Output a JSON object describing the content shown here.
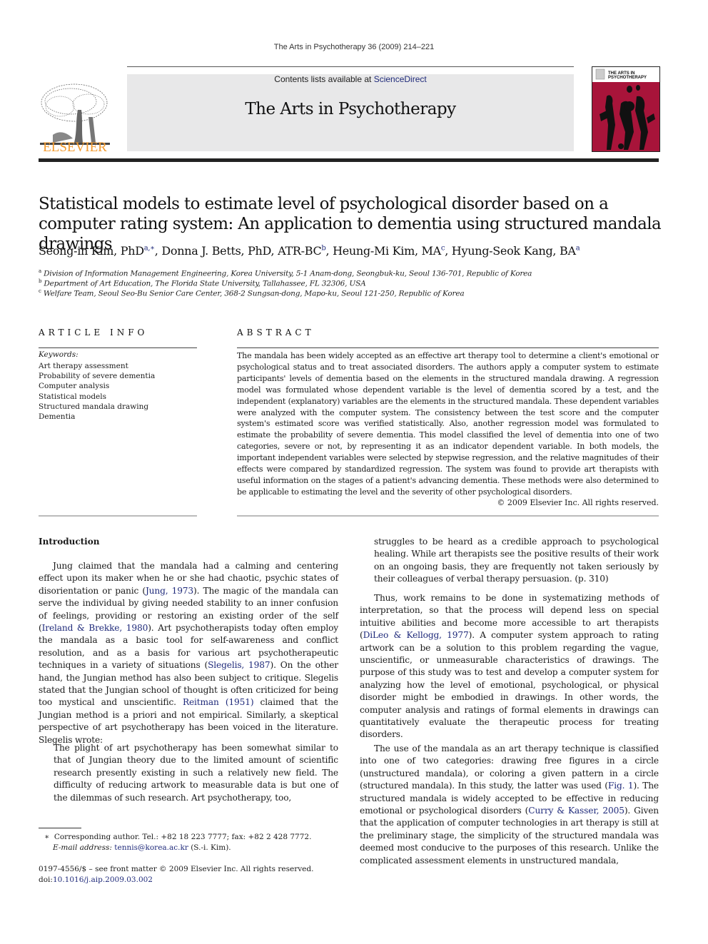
{
  "running_head": "The Arts in Psychotherapy 36 (2009) 214–221",
  "masthead": {
    "contents_prefix": "Contents lists available at ",
    "contents_link": "ScienceDirect",
    "journal_title": "The Arts in Psychotherapy",
    "publisher_wordmark": "ELSEVIER",
    "cover_title_line1": "THE ARTS IN",
    "cover_title_line2": "PSYCHOTHERAPY",
    "colors": {
      "publisher_orange": "#f29a2e",
      "cover_red": "#a8143a",
      "link_blue": "#1f2a7a",
      "masthead_gray": "#e8e8e9"
    }
  },
  "article": {
    "title": "Statistical models to estimate level of psychological disorder based on a computer rating system: An application to dementia using structured mandala drawings",
    "authors": [
      {
        "name": "Seong-in Kim, PhD",
        "sup": "a,∗"
      },
      {
        "name": "Donna J. Betts, PhD, ATR-BC",
        "sup": "b"
      },
      {
        "name": "Heung-Mi Kim, MA",
        "sup": "c"
      },
      {
        "name": "Hyung-Seok Kang, BA",
        "sup": "a"
      }
    ],
    "affiliations": [
      {
        "sup": "a",
        "text": "Division of Information Management Engineering, Korea University, 5-1 Anam-dong, Seongbuk-ku, Seoul 136-701, Republic of Korea"
      },
      {
        "sup": "b",
        "text": "Department of Art Education, The Florida State University, Tallahassee, FL 32306, USA"
      },
      {
        "sup": "c",
        "text": "Welfare Team, Seoul Seo-Bu Senior Care Center, 368-2 Sungsan-dong, Mapo-ku, Seoul 121-250, Republic of Korea"
      }
    ]
  },
  "article_info": {
    "heading": "ARTICLE INFO",
    "keywords_label": "Keywords:",
    "keywords": [
      "Art therapy assessment",
      "Probability of severe dementia",
      "Computer analysis",
      "Statistical models",
      "Structured mandala drawing",
      "Dementia"
    ]
  },
  "abstract": {
    "heading": "ABSTRACT",
    "text": "The mandala has been widely accepted as an effective art therapy tool to determine a client's emotional or psychological status and to treat associated disorders. The authors apply a computer system to estimate participants' levels of dementia based on the elements in the structured mandala drawing. A regression model was formulated whose dependent variable is the level of dementia scored by a test, and the independent (explanatory) variables are the elements in the structured mandala. These dependent variables were analyzed with the computer system. The consistency between the test score and the computer system's estimated score was verified statistically. Also, another regression model was formulated to estimate the probability of severe dementia. This model classified the level of dementia into one of two categories, severe or not, by representing it as an indicator dependent variable. In both models, the important independent variables were selected by stepwise regression, and the relative magnitudes of their effects were compared by standardized regression. The system was found to provide art therapists with useful information on the stages of a patient's advancing dementia. These methods were also determined to be applicable to estimating the level and the severity of other psychological disorders.",
    "copyright": "© 2009 Elsevier Inc. All rights reserved."
  },
  "body": {
    "intro_heading": "Introduction",
    "p1": [
      {
        "t": "Jung claimed that the mandala had a calming and centering effect upon its maker when he or she had chaotic, psychic states of disorientation or panic ("
      },
      {
        "link": "Jung, 1973"
      },
      {
        "t": "). The magic of the mandala can serve the individual by giving needed stability to an inner confusion of feelings, providing or restoring an existing order of the self ("
      },
      {
        "link": "Ireland & Brekke, 1980"
      },
      {
        "t": "). Art psychotherapists today often employ the mandala as a basic tool for self-awareness and conflict resolution, and as a basis for various art psychotherapeutic techniques in a variety of situations ("
      },
      {
        "link": "Slegelis, 1987"
      },
      {
        "t": "). On the other hand, the Jungian method has also been subject to critique. Slegelis stated that the Jungian school of thought is often criticized for being too mystical and unscientific. "
      },
      {
        "link": "Reitman (1951)"
      },
      {
        "t": " claimed that the Jungian method is a priori and not empirical. Similarly, a skeptical perspective of art psychotherapy has been voiced in the literature. Slegelis wrote:"
      }
    ],
    "quote_part1": "The plight of art psychotherapy has been somewhat similar to that of Jungian theory due to the limited amount of scientific research presently existing in such a relatively new field. The difficulty of reducing artwork to measurable data is but one of the dilemmas of such research. Art psychotherapy, too,",
    "quote_part2": "struggles to be heard as a credible approach to psychological healing. While art therapists see the positive results of their work on an ongoing basis, they are frequently not taken seriously by their colleagues of verbal therapy persuasion. (p. 310)",
    "p2": [
      {
        "t": "Thus, work remains to be done in systematizing methods of interpretation, so that the process will depend less on special intuitive abilities and become more accessible to art therapists ("
      },
      {
        "link": "DiLeo & Kellogg, 1977"
      },
      {
        "t": "). A computer system approach to rating artwork can be a solution to this problem regarding the vague, unscientific, or unmeasurable characteristics of drawings. The purpose of this study was to test and develop a computer system for analyzing how the level of emotional, psychological, or physical disorder might be embodied in drawings. In other words, the computer analysis and ratings of formal elements in drawings can quantitatively evaluate the therapeutic process for treating disorders."
      }
    ],
    "p3": [
      {
        "t": "The use of the mandala as an art therapy technique is classified into one of two categories: drawing free figures in a circle (unstructured mandala), or coloring a given pattern in a circle (structured mandala). In this study, the latter was used ("
      },
      {
        "link": "Fig. 1"
      },
      {
        "t": "). The structured mandala is widely accepted to be effective in reducing emotional or psychological disorders ("
      },
      {
        "link": "Curry & Kasser, 2005"
      },
      {
        "t": "). Given that the application of computer technologies in art therapy is still at the preliminary stage, the simplicity of the structured mandala was deemed most conducive to the purposes of this research. Unlike the complicated assessment elements in unstructured mandala,"
      }
    ]
  },
  "footnote": {
    "marker": "∗",
    "corresponding": "Corresponding author. Tel.: +82 18 223 7777; fax: +82 2 428 7772.",
    "email_label": "E-mail address:",
    "email": "tennis@korea.ac.kr",
    "email_suffix": " (S.-i. Kim)."
  },
  "front_matter": {
    "line": "0197-4556/$ – see front matter © 2009 Elsevier Inc. All rights reserved.",
    "doi_label": "doi:",
    "doi": "10.1016/j.aip.2009.03.002"
  }
}
